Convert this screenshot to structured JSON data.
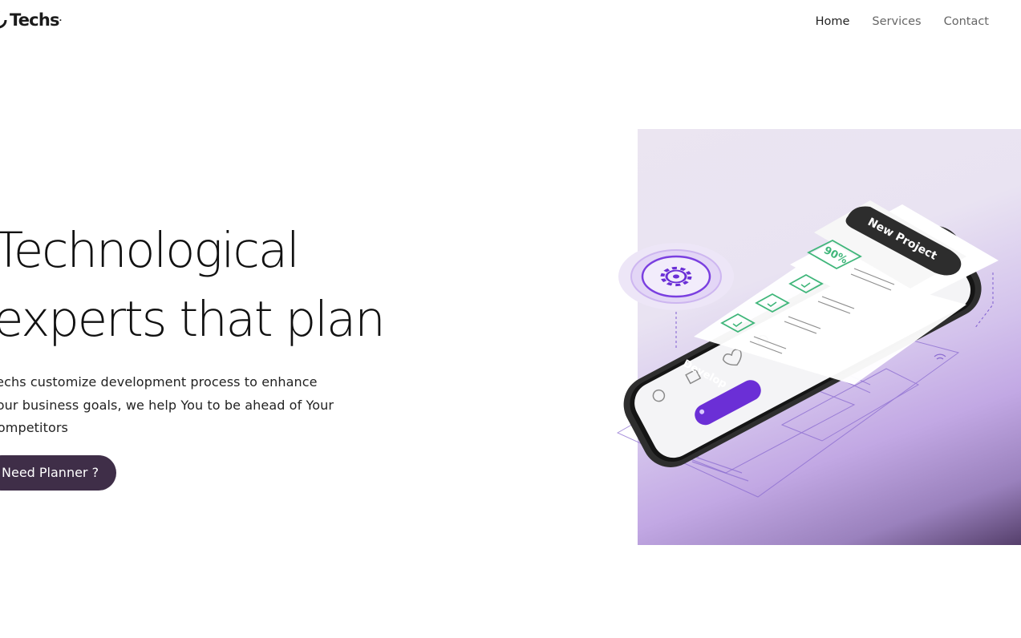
{
  "header": {
    "logo_text": "Techs",
    "logo_mark": "·",
    "nav": [
      {
        "label": "Home",
        "active": true
      },
      {
        "label": "Services",
        "active": false
      },
      {
        "label": "Contact",
        "active": false
      }
    ]
  },
  "hero": {
    "title_line1": "Technological",
    "title_line2": "experts that plan",
    "description": "Techs customize development process to enhance Your business goals, we help You to be ahead of Your competitors",
    "cta_label": "Need Planner ?"
  },
  "illustration": {
    "card_title": "New Project",
    "progress_badge": "90%",
    "phone_button": "Develop",
    "colors": {
      "accent": "#6b2fd6",
      "check": "#3fb67a",
      "cta": "#3f2e48"
    },
    "icons": [
      "gear-icon",
      "user-icon",
      "chart-icon",
      "heart-icon",
      "settings-icon",
      "wifi-icon"
    ]
  }
}
